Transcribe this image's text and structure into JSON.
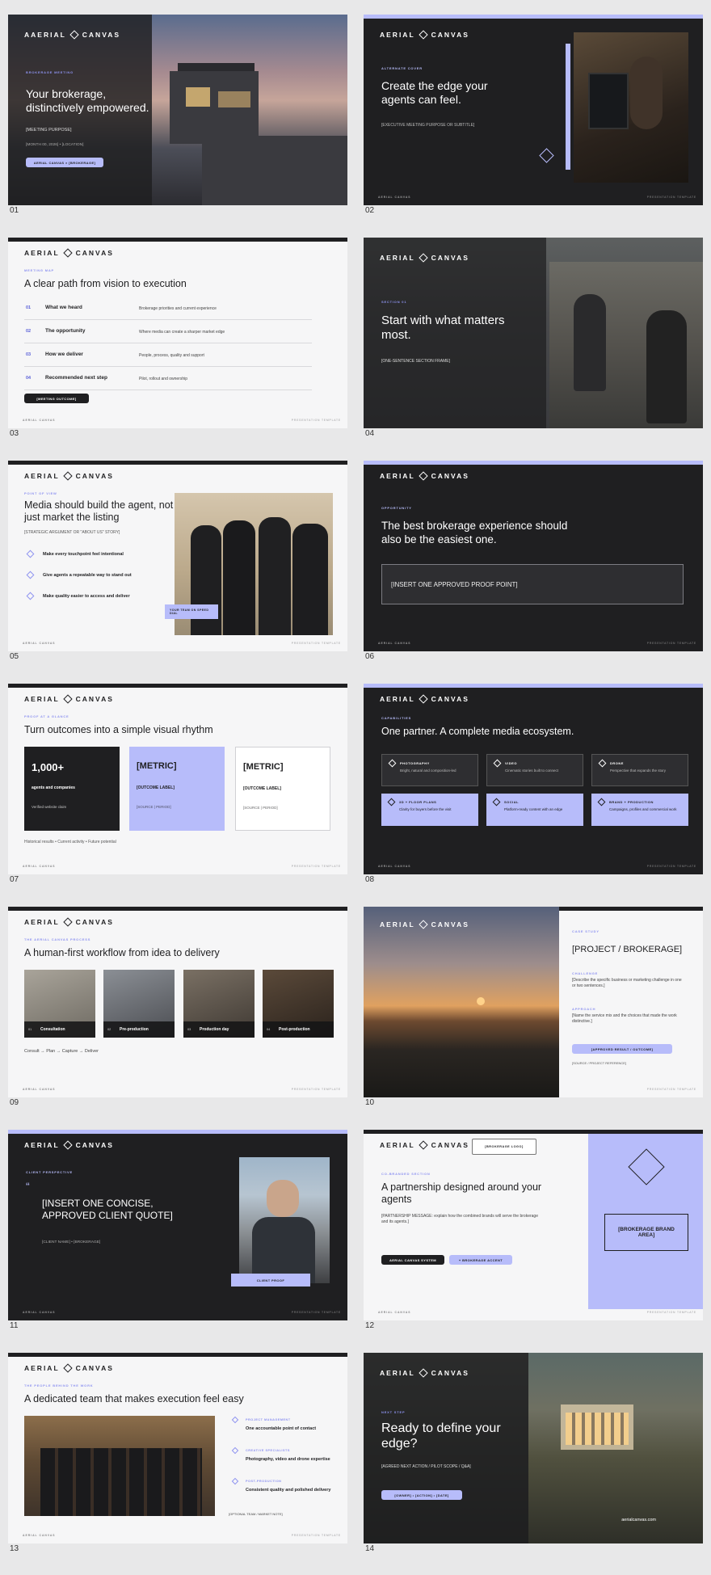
{
  "brand": "AERIAL CANVAS",
  "footer_left": "AERIAL CANVAS",
  "footer_right": "PRESENTATION TEMPLATE",
  "colors": {
    "accent": "#b7bcfa",
    "dark": "#1f1f21",
    "light": "#f6f6f7"
  },
  "slides": [
    {
      "num": "01",
      "eyebrow": "BROKERAGE MEETING",
      "title": "Your brokerage, distinctively empowered.",
      "purpose": "[MEETING PURPOSE]",
      "meta": "[MONTH 00, 2026] • [LOCATION]",
      "pill": "AERIAL CANVAS × [BROKERAGE]"
    },
    {
      "num": "02",
      "eyebrow": "ALTERNATE COVER",
      "title": "Create the edge your agents can feel.",
      "subtitle": "[EXECUTIVE MEETING PURPOSE OR SUBTITLE]"
    },
    {
      "num": "03",
      "eyebrow": "MEETING MAP",
      "title": "A clear path from vision to execution",
      "rows": [
        {
          "n": "01",
          "t": "What we heard",
          "d": "Brokerage priorities and current experience"
        },
        {
          "n": "02",
          "t": "The opportunity",
          "d": "Where media can create a sharper market edge"
        },
        {
          "n": "03",
          "t": "How we deliver",
          "d": "People, process, quality and support"
        },
        {
          "n": "04",
          "t": "Recommended next step",
          "d": "Pilot, rollout and ownership"
        }
      ],
      "pill": "[MEETING OUTCOME]"
    },
    {
      "num": "04",
      "eyebrow": "SECTION 01",
      "title": "Start with what matters most.",
      "subtitle": "[ONE-SENTENCE SECTION FRAME]"
    },
    {
      "num": "05",
      "eyebrow": "POINT OF VIEW",
      "title": "Media should build the agent, not just market the listing",
      "subtitle": "[STRATEGIC ARGUMENT OR \"ABOUT US\" STORY]",
      "points": [
        "Make every touchpoint feel intentional",
        "Give agents a repeatable way to stand out",
        "Make quality easier to access and deliver"
      ],
      "badge": "YOUR TEAM ON SPEED DIAL"
    },
    {
      "num": "06",
      "eyebrow": "OPPORTUNITY",
      "title": "The best brokerage experience should also be the easiest one.",
      "proof": "[INSERT ONE APPROVED PROOF POINT]"
    },
    {
      "num": "07",
      "eyebrow": "PROOF AT A GLANCE",
      "title": "Turn outcomes into a simple visual rhythm",
      "cards": [
        {
          "big": "1,000+",
          "label": "agents and companies",
          "src": "Verified website claim"
        },
        {
          "big": "[METRIC]",
          "label": "[OUTCOME LABEL]",
          "src": "[SOURCE | PERIOD]"
        },
        {
          "big": "[METRIC]",
          "label": "[OUTCOME LABEL]",
          "src": "[SOURCE | PERIOD]"
        }
      ],
      "note": "Historical results • Current activity • Future potential"
    },
    {
      "num": "08",
      "eyebrow": "CAPABILITIES",
      "title": "One partner. A complete media ecosystem.",
      "caps": [
        {
          "h": "PHOTOGRAPHY",
          "d": "Bright, natural and composition-led"
        },
        {
          "h": "VIDEO",
          "d": "Cinematic stories built to connect"
        },
        {
          "h": "DRONE",
          "d": "Perspective that expands the story"
        },
        {
          "h": "3D + FLOOR PLANS",
          "d": "Clarity for buyers before the visit"
        },
        {
          "h": "SOCIAL",
          "d": "Platform-ready content with an edge"
        },
        {
          "h": "BRAND + PRODUCTION",
          "d": "Campaigns, profiles and commercial work"
        }
      ]
    },
    {
      "num": "09",
      "eyebrow": "THE AERIAL CANVAS PROCESS",
      "title": "A human-first workflow from idea to delivery",
      "steps": [
        {
          "n": "01",
          "t": "Consultation"
        },
        {
          "n": "02",
          "t": "Pre-production"
        },
        {
          "n": "03",
          "t": "Production day"
        },
        {
          "n": "04",
          "t": "Post-production"
        }
      ],
      "flow": "Consult → Plan → Capture → Deliver"
    },
    {
      "num": "10",
      "eyebrow": "CASE STUDY",
      "title": "[PROJECT / BROKERAGE]",
      "challenge_label": "CHALLENGE",
      "challenge": "[Describe the specific business or marketing challenge in one or two sentences.]",
      "approach_label": "APPROACH",
      "approach": "[Name the service mix and the choices that made the work distinctive.]",
      "pill": "[APPROVED RESULT / OUTCOME]",
      "source": "[SOURCE / PROJECT REFERENCE]"
    },
    {
      "num": "11",
      "eyebrow": "CLIENT PERSPECTIVE",
      "quote_mark": "“",
      "quote": "[INSERT ONE CONCISE, APPROVED CLIENT QUOTE]",
      "attrib": "[CLIENT NAME] • [BROKERAGE]",
      "badge": "CLIENT PROOF"
    },
    {
      "num": "12",
      "logo_box": "[BROKERAGE LOGO]",
      "times": "×",
      "eyebrow": "CO-BRANDED SECTION",
      "title": "A partnership designed around your agents",
      "subtitle": "[PARTNERSHIP MESSAGE: explain how the combined brands will serve the brokerage and its agents.]",
      "pill1": "AERIAL CANVAS SYSTEM",
      "pill2": "+ BROKERAGE ACCENT",
      "brand_area": "[BROKERAGE BRAND AREA]"
    },
    {
      "num": "13",
      "eyebrow": "THE PEOPLE BEHIND THE WORK",
      "title": "A dedicated team that makes execution feel easy",
      "team": [
        {
          "h": "PROJECT MANAGEMENT",
          "d": "One accountable point of contact"
        },
        {
          "h": "CREATIVE SPECIALISTS",
          "d": "Photography, video and drone expertise"
        },
        {
          "h": "POST-PRODUCTION",
          "d": "Consistent quality and polished delivery"
        }
      ],
      "note": "[OPTIONAL TEAM / MARKET NOTE]"
    },
    {
      "num": "14",
      "eyebrow": "NEXT STEP",
      "title": "Ready to define your edge?",
      "subtitle": "[AGREED NEXT ACTION / PILOT SCOPE / Q&A]",
      "pill": "[OWNER] • [ACTION] • [DATE]",
      "url": "aerialcanvas.com"
    }
  ]
}
